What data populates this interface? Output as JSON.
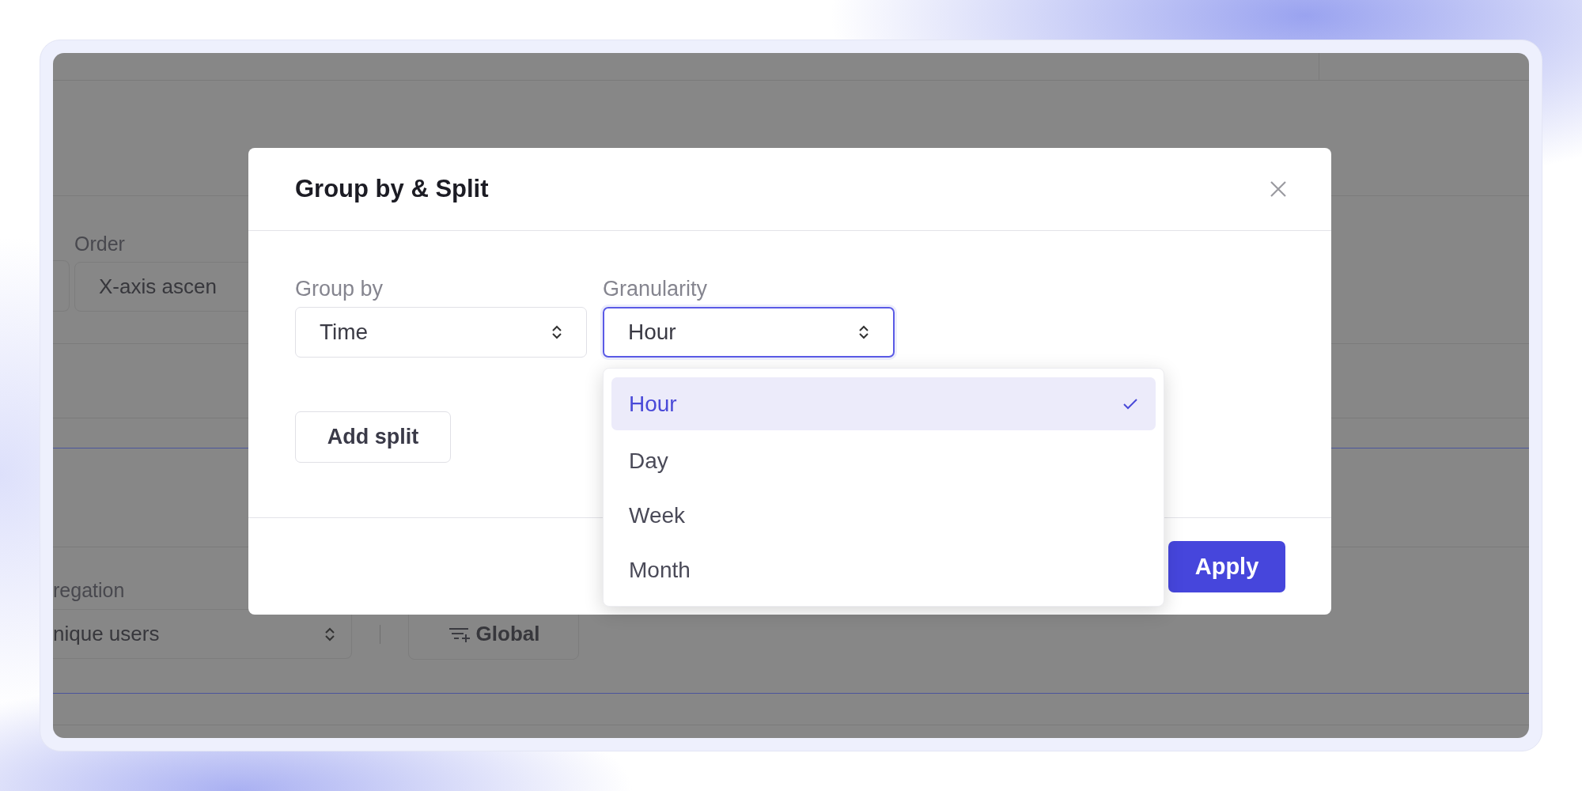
{
  "background": {
    "order_label": "Order",
    "order_select": "X-axis ascen",
    "aggregation_label": "regation",
    "aggregation_select": "nique users",
    "global_button": "Global"
  },
  "dialog": {
    "title": "Group by & Split",
    "fields": [
      {
        "label": "Group by",
        "value": "Time",
        "focused": false
      },
      {
        "label": "Granularity",
        "value": "Hour",
        "focused": true
      }
    ],
    "add_split_button": "Add split",
    "dropdown": {
      "options": [
        {
          "label": "Hour",
          "selected": true
        },
        {
          "label": "Day",
          "selected": false
        },
        {
          "label": "Week",
          "selected": false
        },
        {
          "label": "Month",
          "selected": false
        }
      ]
    },
    "apply_button": "Apply"
  }
}
